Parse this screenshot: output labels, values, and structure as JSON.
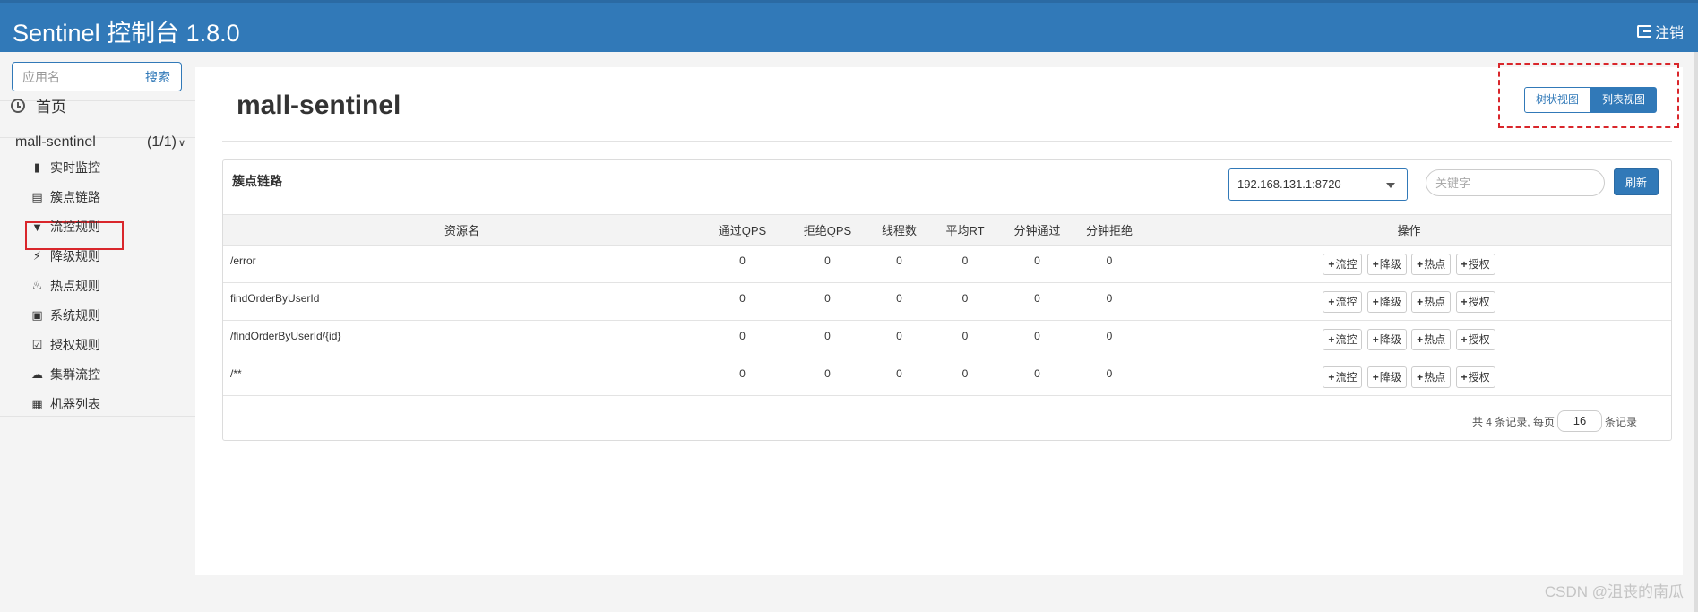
{
  "header": {
    "brand": "Sentinel 控制台 1.8.0",
    "logout_label": "注销"
  },
  "sidebar": {
    "search_placeholder": "应用名",
    "search_button": "搜索",
    "home_label": "首页",
    "app_name": "mall-sentinel",
    "app_count": "(1/1)",
    "items": [
      {
        "label": "实时监控",
        "icon": "bar-chart-icon"
      },
      {
        "label": "簇点链路",
        "icon": "list-icon"
      },
      {
        "label": "流控规则",
        "icon": "filter-icon"
      },
      {
        "label": "降级规则",
        "icon": "bolt-icon"
      },
      {
        "label": "热点规则",
        "icon": "fire-icon"
      },
      {
        "label": "系统规则",
        "icon": "lock-icon"
      },
      {
        "label": "授权规则",
        "icon": "check-square-icon"
      },
      {
        "label": "集群流控",
        "icon": "cloud-icon"
      },
      {
        "label": "机器列表",
        "icon": "th-list-icon"
      }
    ],
    "active_item": "簇点链路"
  },
  "main": {
    "title": "mall-sentinel",
    "view_tree": "树状视图",
    "view_list": "列表视图",
    "panel_title": "簇点链路",
    "machine_select": "192.168.131.1:8720",
    "keyword_placeholder": "关键字",
    "refresh_button": "刷新",
    "columns": [
      "资源名",
      "通过QPS",
      "拒绝QPS",
      "线程数",
      "平均RT",
      "分钟通过",
      "分钟拒绝",
      "操作"
    ],
    "rows": [
      {
        "resource": "/error",
        "pass_qps": "0",
        "block_qps": "0",
        "threads": "0",
        "avg_rt": "0",
        "min_pass": "0",
        "min_block": "0"
      },
      {
        "resource": "findOrderByUserId",
        "pass_qps": "0",
        "block_qps": "0",
        "threads": "0",
        "avg_rt": "0",
        "min_pass": "0",
        "min_block": "0"
      },
      {
        "resource": "/findOrderByUserId/{id}",
        "pass_qps": "0",
        "block_qps": "0",
        "threads": "0",
        "avg_rt": "0",
        "min_pass": "0",
        "min_block": "0"
      },
      {
        "resource": "/**",
        "pass_qps": "0",
        "block_qps": "0",
        "threads": "0",
        "avg_rt": "0",
        "min_pass": "0",
        "min_block": "0"
      }
    ],
    "op_buttons": [
      "流控",
      "降级",
      "热点",
      "授权"
    ],
    "pager": {
      "prefix": "共 4 条记录, 每页",
      "page_size": "16",
      "suffix": "条记录"
    }
  },
  "watermark": "CSDN @沮丧的南瓜",
  "colors": {
    "primary": "#3179b8",
    "highlight": "#d9262b"
  }
}
